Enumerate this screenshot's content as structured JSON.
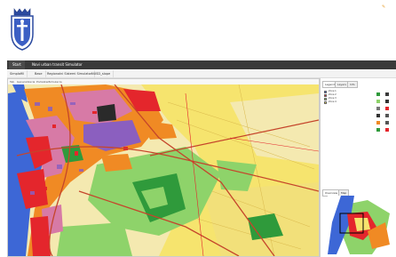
{
  "header": {
    "crest": "city-coat-of-arms"
  },
  "topbar": {
    "tabs": [
      {
        "label": "Start"
      },
      {
        "label": "Novi urban transit Simulator"
      }
    ]
  },
  "breadcrumbs": [
    {
      "label": "Simplafill"
    },
    {
      "label": "Base"
    },
    {
      "label": "Regionalni Sistemi Simulator"
    },
    {
      "label": "NUSD_slope"
    }
  ],
  "map": {
    "toolbar": [
      "Tab",
      "Generalizacia",
      "Podsistem",
      "Simulacia"
    ],
    "title": "Slope map",
    "colors": {
      "water": "#3d67d6",
      "urban_red": "#e4262c",
      "urban_orange": "#f08a24",
      "urban_pink": "#d77aa6",
      "urban_purple": "#8b5fbf",
      "green_light": "#8ed36a",
      "green_dark": "#2f9a3b",
      "agri_yellow": "#f6e46e",
      "agri_cream": "#f4e9b0",
      "road": "#c5452b"
    }
  },
  "sidepanel": {
    "tabs": [
      {
        "label": "Legend"
      },
      {
        "label": "Layers"
      },
      {
        "label": "Info"
      }
    ],
    "legend": [
      {
        "label": "Zone 1",
        "color": "#3d67d6"
      },
      {
        "label": "Zone 2",
        "color": "#e4262c"
      },
      {
        "label": "Zone 3",
        "color": "#8ed36a"
      },
      {
        "label": "Zone 4",
        "color": "#f6e46e"
      }
    ],
    "tools": [
      {
        "icon": "zoom-in-icon",
        "color": "#2f9a3b"
      },
      {
        "icon": "zoom-out-icon",
        "color": "#3a3a3a"
      },
      {
        "icon": "pan-icon",
        "color": "#8ed36a"
      },
      {
        "icon": "info-icon",
        "color": "#333"
      },
      {
        "icon": "measure-icon",
        "color": "#777"
      },
      {
        "icon": "select-icon",
        "color": "#e4262c"
      },
      {
        "icon": "layer-icon",
        "color": "#333"
      },
      {
        "icon": "print-icon",
        "color": "#555"
      },
      {
        "icon": "query-icon",
        "color": "#f08a24"
      },
      {
        "icon": "home-icon",
        "color": "#555"
      },
      {
        "icon": "extent-icon",
        "color": "#2f9a3b"
      },
      {
        "icon": "clear-icon",
        "color": "#e4262c"
      }
    ],
    "overview_tabs": [
      {
        "label": "Overview"
      },
      {
        "label": "Map"
      }
    ]
  }
}
